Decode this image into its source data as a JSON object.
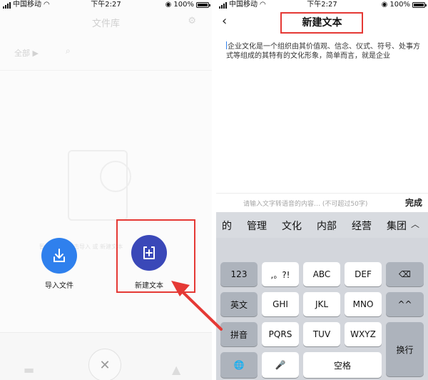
{
  "left": {
    "status": {
      "carrier": "中国移动",
      "time": "下午2:27",
      "battery": "100%"
    },
    "header": {
      "title": "文件库",
      "gear_icon": "gear-icon"
    },
    "tab": {
      "label": "全部 ▶"
    },
    "empty_hint": "暂无文件，点击导入 或 新建文本",
    "buttons": {
      "import_label": "导入文件",
      "new_label": "新建文本"
    },
    "bottom": {
      "plus": "✕"
    }
  },
  "right": {
    "status": {
      "carrier": "中国移动",
      "time": "下午2:27",
      "battery": "100%"
    },
    "nav": {
      "back": "‹",
      "title": "新建文本"
    },
    "editor": {
      "text": "企业文化是一个组织由其价值观、信念、仪式、符号、处事方式等组成的其特有的文化形象，简单而言，就是企业"
    },
    "tts": {
      "placeholder": "请输入文字转语音的内容… (不可超过50字)",
      "done": "完成"
    },
    "keyboard": {
      "candidates": [
        "的",
        "管理",
        "文化",
        "内部",
        "经营",
        "集团"
      ],
      "rows": [
        [
          "123",
          ",。?!",
          "ABC",
          "DEF",
          "⌫"
        ],
        [
          "英文",
          "GHI",
          "JKL",
          "MNO",
          "^^"
        ],
        [
          "拼音",
          "PQRS",
          "TUV",
          "WXYZ",
          "换行"
        ],
        [
          "🌐",
          "🎤",
          "空格"
        ]
      ]
    }
  },
  "colors": {
    "import": "#2f80ed",
    "new": "#3a48b8",
    "highlight": "#e53935"
  }
}
